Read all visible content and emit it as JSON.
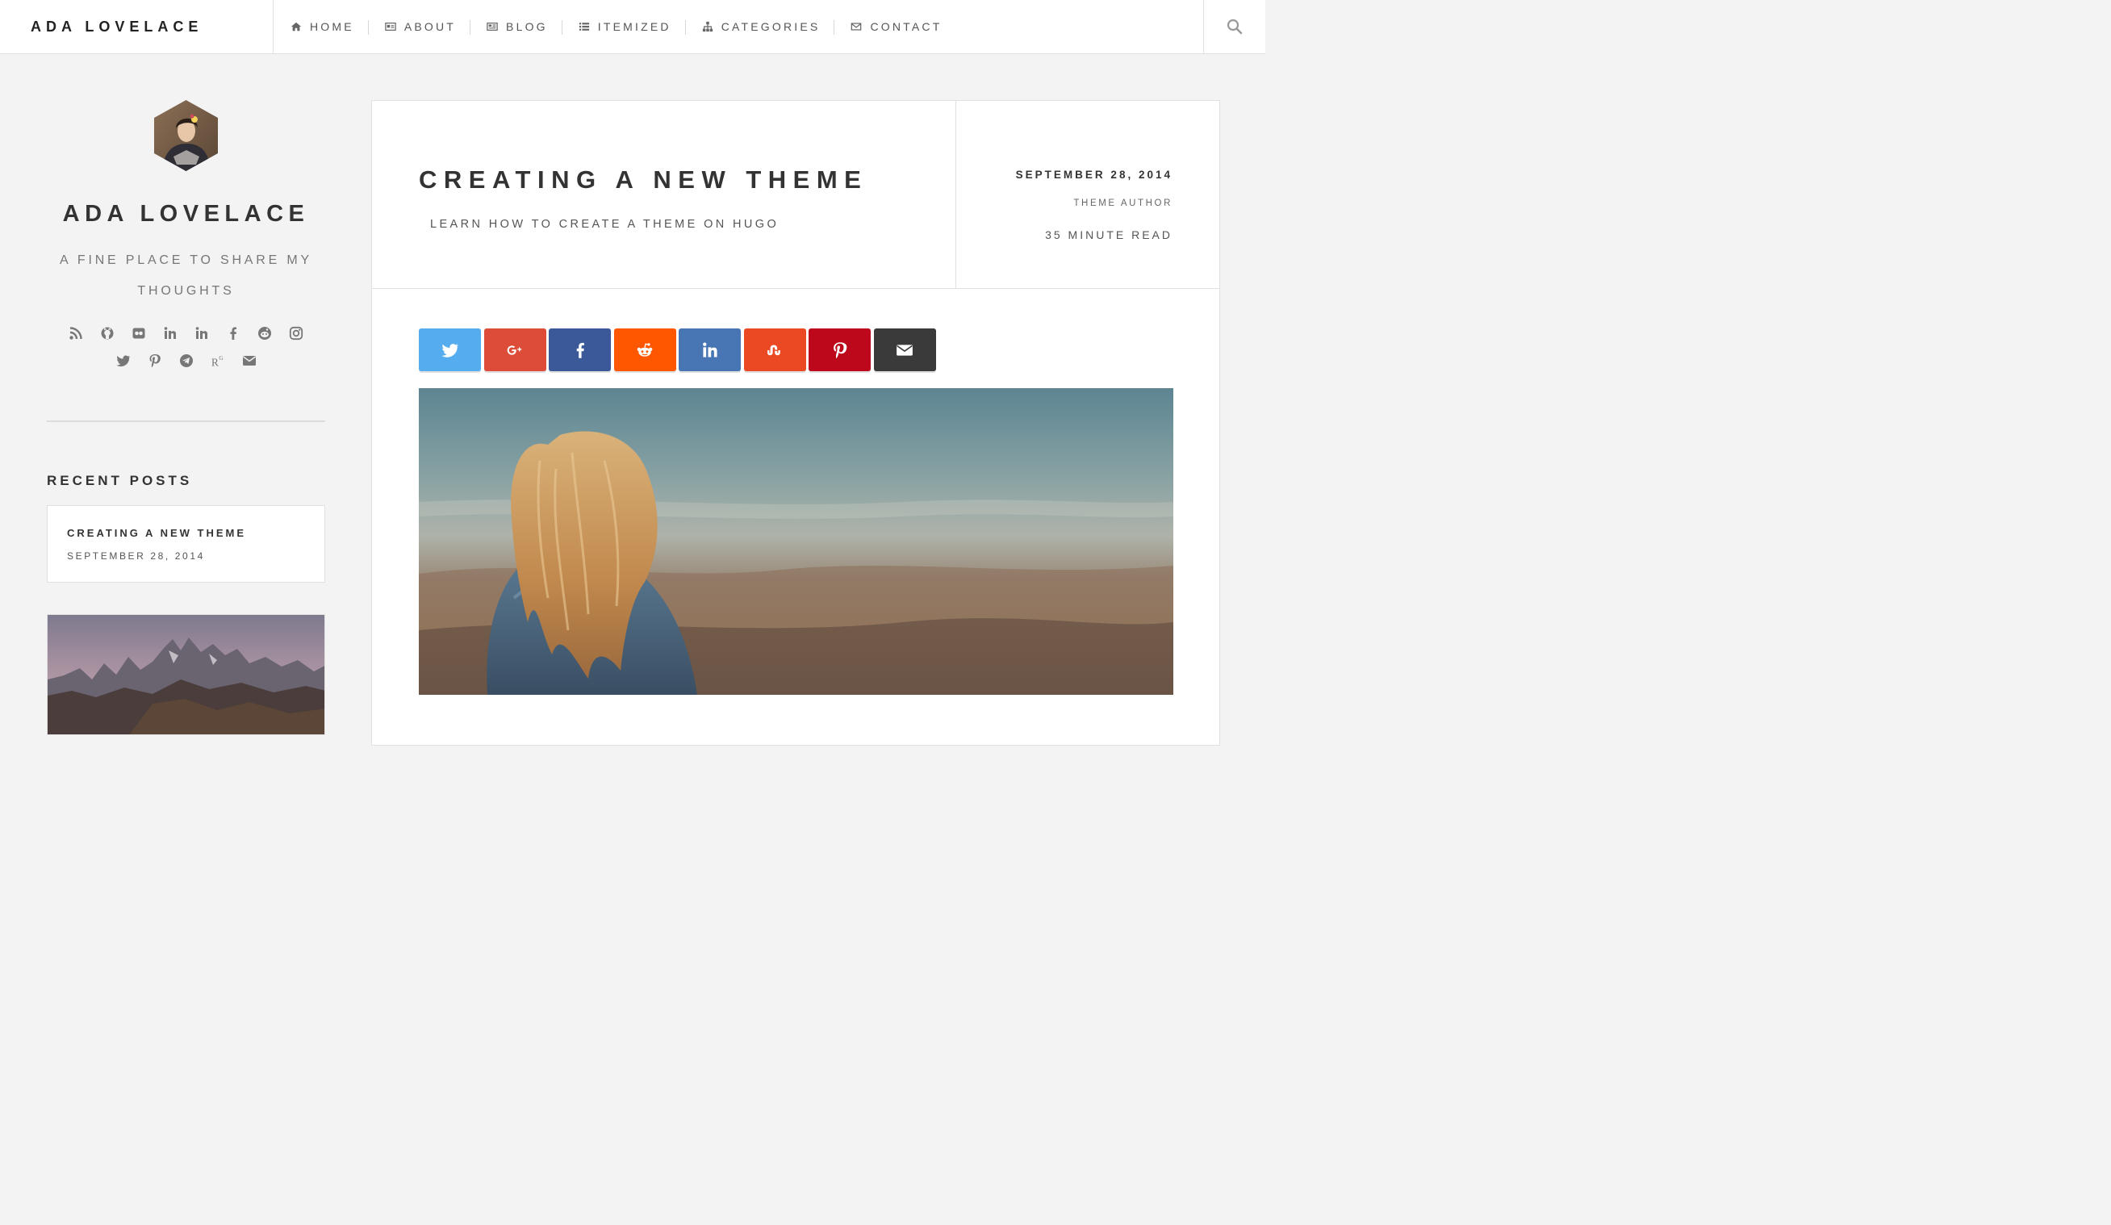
{
  "header": {
    "brand": "ADA LOVELACE",
    "nav": [
      {
        "label": "HOME",
        "icon": "home-icon"
      },
      {
        "label": "ABOUT",
        "icon": "id-card-icon"
      },
      {
        "label": "BLOG",
        "icon": "newspaper-icon"
      },
      {
        "label": "ITEMIZED",
        "icon": "list-icon"
      },
      {
        "label": "CATEGORIES",
        "icon": "sitemap-icon"
      },
      {
        "label": "CONTACT",
        "icon": "envelope-icon"
      }
    ],
    "search_icon": "search-icon"
  },
  "sidebar": {
    "title": "ADA LOVELACE",
    "tagline": "A FINE PLACE TO SHARE MY THOUGHTS",
    "social_row1": [
      "rss-icon",
      "github-icon",
      "flickr-icon",
      "linkedin-icon",
      "linkedin-icon",
      "facebook-icon",
      "reddit-icon",
      "instagram-icon"
    ],
    "social_row2": [
      "twitter-icon",
      "pinterest-icon",
      "telegram-icon",
      "researchgate-icon",
      "email-icon"
    ],
    "recent_heading": "RECENT POSTS",
    "recent_posts": [
      {
        "title": "CREATING A NEW THEME",
        "date": "SEPTEMBER 28, 2014"
      }
    ]
  },
  "post": {
    "title": "CREATING A NEW THEME",
    "subtitle": "LEARN HOW TO CREATE A THEME ON HUGO",
    "date": "SEPTEMBER 28, 2014",
    "author": "THEME AUTHOR",
    "read_time": "35 MINUTE READ",
    "share": [
      {
        "name": "twitter",
        "color": "#55acee"
      },
      {
        "name": "google-plus",
        "color": "#dd4b39"
      },
      {
        "name": "facebook",
        "color": "#3b5998"
      },
      {
        "name": "reddit",
        "color": "#ff5700"
      },
      {
        "name": "linkedin",
        "color": "#4875b4"
      },
      {
        "name": "stumbleupon",
        "color": "#eb4924"
      },
      {
        "name": "pinterest",
        "color": "#bd081c"
      },
      {
        "name": "email",
        "color": "#3a3a3a"
      }
    ]
  },
  "colors": {
    "background": "#f3f3f3",
    "text": "#333333"
  }
}
